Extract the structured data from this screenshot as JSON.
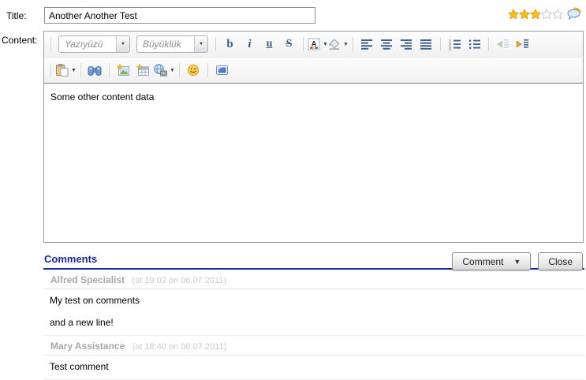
{
  "form": {
    "title": {
      "label": "Title:",
      "value": "Another Another Test"
    },
    "content_label": "Content:",
    "rating": {
      "stars_filled": 3,
      "stars_total": 5,
      "filled_color": "#fdc116",
      "filled_stroke": "#e0920f",
      "empty_color": "#ffffff",
      "empty_stroke": "#bfbfbf",
      "bubble_icon": "comment-bubble-icon"
    }
  },
  "editor": {
    "font_combo": {
      "value": "Yazıyüzü"
    },
    "size_combo": {
      "value": "Büyüklük"
    },
    "glyphs": {
      "bold": "b",
      "italic": "i",
      "underline": "u",
      "strikethrough": "S"
    },
    "toolbar_row1_icons": [
      "bold",
      "italic",
      "underline",
      "strikethrough",
      "font-color",
      "background-color",
      "align-left",
      "align-center",
      "align-right",
      "justify",
      "ordered-list",
      "unordered-list",
      "outdent",
      "indent"
    ],
    "toolbar_row2_icons": [
      "paste",
      "find",
      "insert-image",
      "insert-table",
      "insert-media",
      "emoticon",
      "preview"
    ],
    "content_text": "Some other content data"
  },
  "comments": {
    "heading": "Comments",
    "comment_button_label": "Comment",
    "close_button_label": "Close",
    "items": [
      {
        "author": "Alfred Specialist",
        "timestamp": "(at 19:02 on 06.07.2011)",
        "body_lines": [
          "My test on comments",
          "",
          "and a new line!"
        ]
      },
      {
        "author": "Mary Assistance",
        "timestamp": "(at 18:40 on 06.07.2011)",
        "body_lines": [
          "Test comment"
        ]
      }
    ]
  },
  "colors": {
    "accent_navy": "#1b2a9b",
    "toolbar_icon_blue": "#3a5f85",
    "star_gold": "#fdc116",
    "author_gray": "#a8a8a8",
    "timestamp_gray": "#cbcbcb"
  }
}
